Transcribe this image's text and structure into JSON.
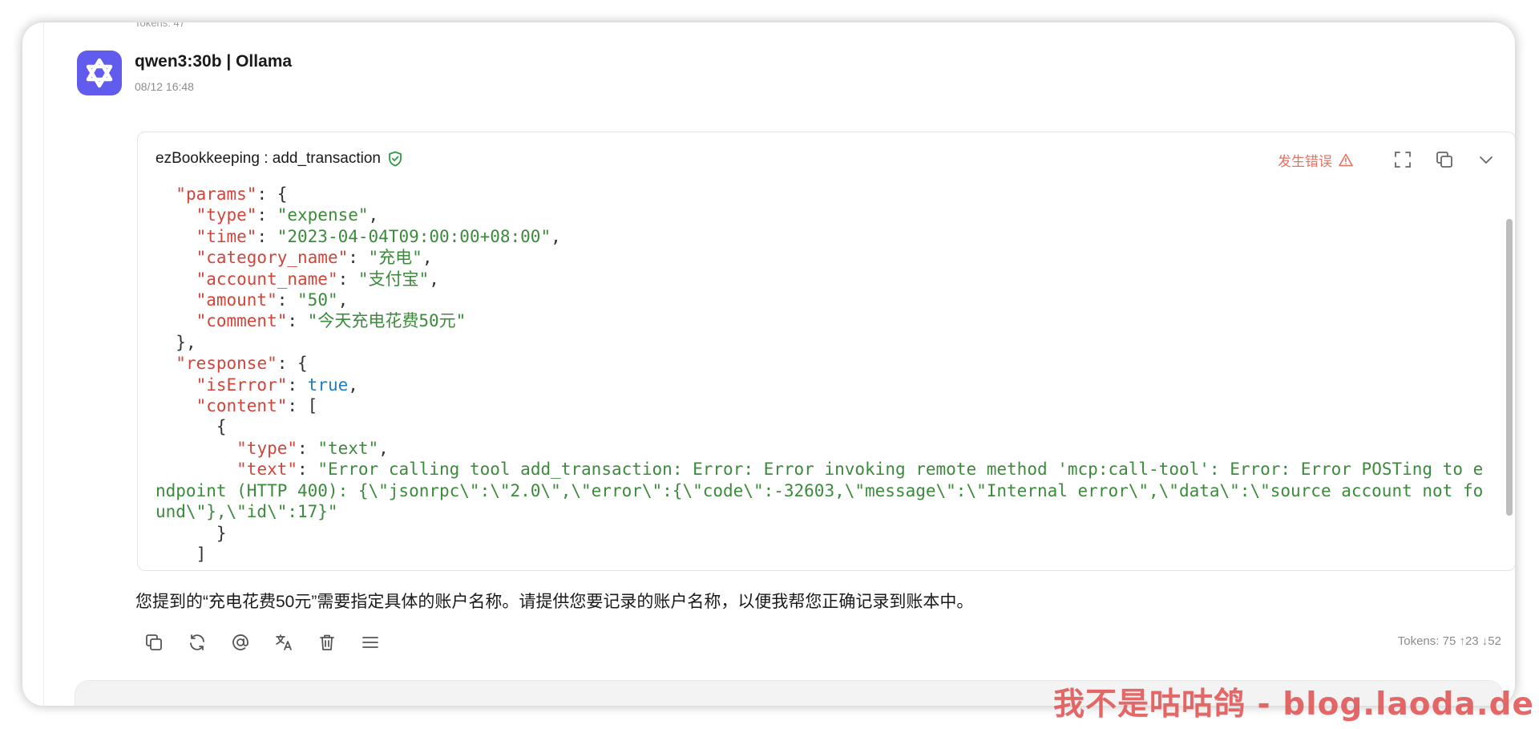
{
  "previous_tokens": "Tokens: 47",
  "message": {
    "model": "qwen3:30b | Ollama",
    "time": "08/12 16:48"
  },
  "tool_call": {
    "title": "ezBookkeeping : add_transaction",
    "error_label": "发生错误",
    "code_lines": [
      {
        "indent": "  ",
        "parts": [
          {
            "t": "k",
            "v": "\"params\""
          },
          {
            "t": "p",
            "v": ": {"
          }
        ]
      },
      {
        "indent": "    ",
        "parts": [
          {
            "t": "k",
            "v": "\"type\""
          },
          {
            "t": "p",
            "v": ": "
          },
          {
            "t": "s",
            "v": "\"expense\""
          },
          {
            "t": "p",
            "v": ","
          }
        ]
      },
      {
        "indent": "    ",
        "parts": [
          {
            "t": "k",
            "v": "\"time\""
          },
          {
            "t": "p",
            "v": ": "
          },
          {
            "t": "s",
            "v": "\"2023-04-04T09:00:00+08:00\""
          },
          {
            "t": "p",
            "v": ","
          }
        ]
      },
      {
        "indent": "    ",
        "parts": [
          {
            "t": "k",
            "v": "\"category_name\""
          },
          {
            "t": "p",
            "v": ": "
          },
          {
            "t": "s",
            "v": "\"充电\""
          },
          {
            "t": "p",
            "v": ","
          }
        ]
      },
      {
        "indent": "    ",
        "parts": [
          {
            "t": "k",
            "v": "\"account_name\""
          },
          {
            "t": "p",
            "v": ": "
          },
          {
            "t": "s",
            "v": "\"支付宝\""
          },
          {
            "t": "p",
            "v": ","
          }
        ]
      },
      {
        "indent": "    ",
        "parts": [
          {
            "t": "k",
            "v": "\"amount\""
          },
          {
            "t": "p",
            "v": ": "
          },
          {
            "t": "s",
            "v": "\"50\""
          },
          {
            "t": "p",
            "v": ","
          }
        ]
      },
      {
        "indent": "    ",
        "parts": [
          {
            "t": "k",
            "v": "\"comment\""
          },
          {
            "t": "p",
            "v": ": "
          },
          {
            "t": "s",
            "v": "\"今天充电花费50元\""
          }
        ]
      },
      {
        "indent": "  ",
        "parts": [
          {
            "t": "p",
            "v": "},"
          }
        ]
      },
      {
        "indent": "  ",
        "parts": [
          {
            "t": "k",
            "v": "\"response\""
          },
          {
            "t": "p",
            "v": ": {"
          }
        ]
      },
      {
        "indent": "    ",
        "parts": [
          {
            "t": "k",
            "v": "\"isError\""
          },
          {
            "t": "p",
            "v": ": "
          },
          {
            "t": "b",
            "v": "true"
          },
          {
            "t": "p",
            "v": ","
          }
        ]
      },
      {
        "indent": "    ",
        "parts": [
          {
            "t": "k",
            "v": "\"content\""
          },
          {
            "t": "p",
            "v": ": ["
          }
        ]
      },
      {
        "indent": "      ",
        "parts": [
          {
            "t": "p",
            "v": "{"
          }
        ]
      },
      {
        "indent": "        ",
        "parts": [
          {
            "t": "k",
            "v": "\"type\""
          },
          {
            "t": "p",
            "v": ": "
          },
          {
            "t": "s",
            "v": "\"text\""
          },
          {
            "t": "p",
            "v": ","
          }
        ]
      },
      {
        "indent": "        ",
        "parts": [
          {
            "t": "k",
            "v": "\"text\""
          },
          {
            "t": "p",
            "v": ": "
          },
          {
            "t": "s",
            "v": "\"Error calling tool add_transaction: Error: Error invoking remote method 'mcp:call-tool': Error: Error POSTing to endpoint (HTTP 400): {\\\"jsonrpc\\\":\\\"2.0\\\",\\\"error\\\":{\\\"code\\\":-32603,\\\"message\\\":\\\"Internal error\\\",\\\"data\\\":\\\"source account not found\\\"},\\\"id\\\":17}\""
          }
        ]
      },
      {
        "indent": "      ",
        "parts": [
          {
            "t": "p",
            "v": "}"
          }
        ]
      },
      {
        "indent": "    ",
        "parts": [
          {
            "t": "p",
            "v": "]"
          }
        ]
      }
    ]
  },
  "reply_text": "您提到的“充电花费50元”需要指定具体的账户名称。请提供您要记录的账户名称，以便我帮您正确记录到账本中。",
  "toolbar": [
    "copy-icon",
    "regenerate-icon",
    "mention-icon",
    "translate-icon",
    "delete-icon",
    "menu-icon"
  ],
  "tokens": "Tokens: 75 ↑23 ↓52",
  "watermark": "我不是咕咕鸽 - blog.laoda.de",
  "colors": {
    "avatar_bg": "#615ced",
    "error": "#e8705f",
    "json_key": "#d1453b",
    "json_string": "#3c8a3c",
    "json_bool": "#1f7ec2",
    "verified": "#2e9a46"
  }
}
